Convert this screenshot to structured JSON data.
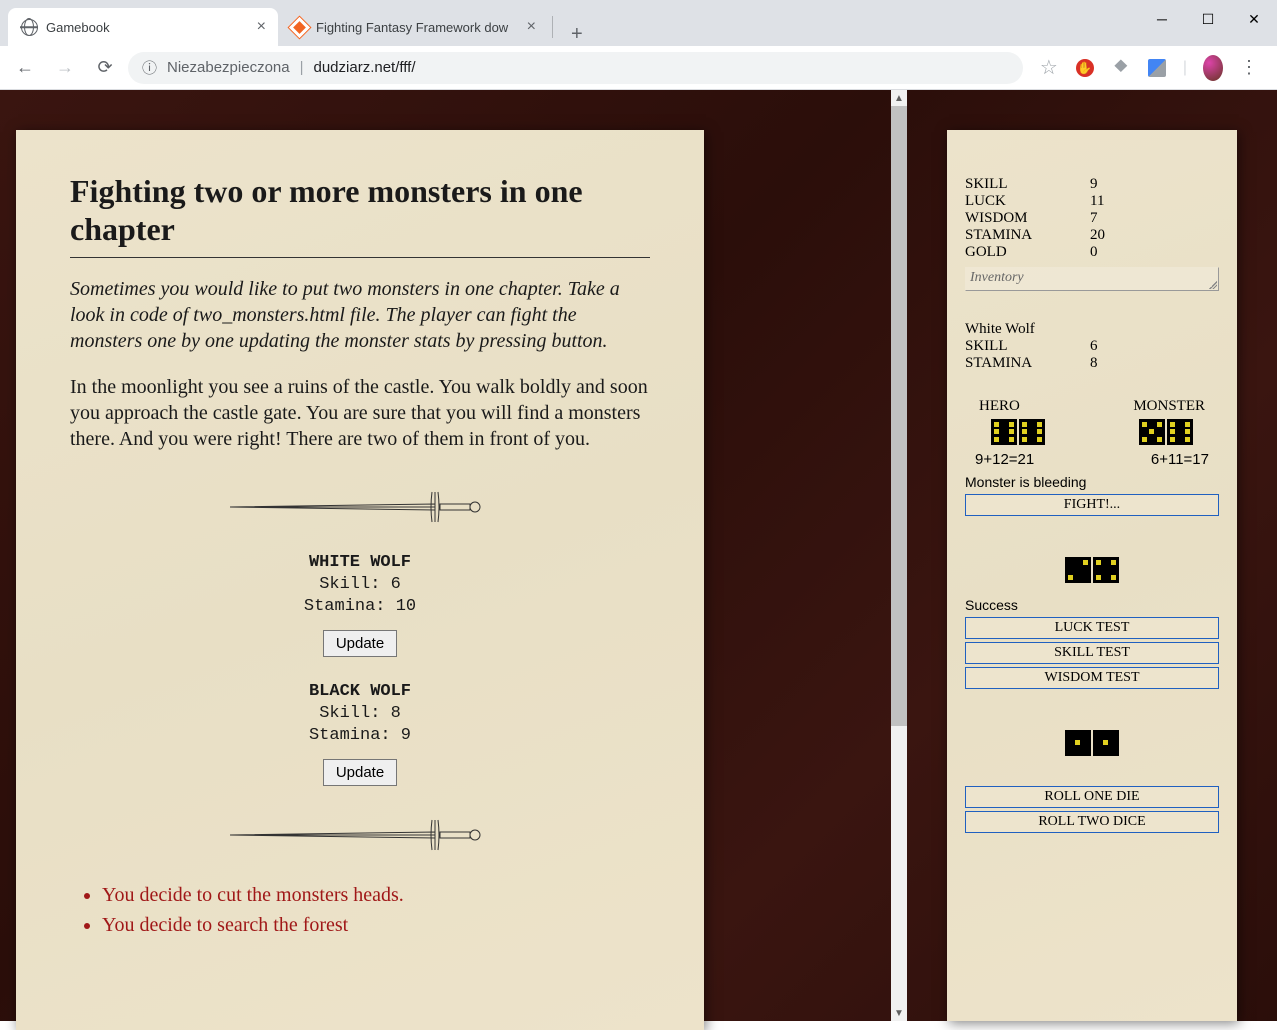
{
  "browser": {
    "tabs": [
      {
        "title": "Gamebook",
        "active": true
      },
      {
        "title": "Fighting Fantasy Framework dow",
        "active": false
      }
    ],
    "url_security": "Niezabezpieczona",
    "url": "dudziarz.net/fff/"
  },
  "page": {
    "title": "Fighting two or more monsters in one chapter",
    "intro": "Sometimes you would like to put two monsters in one chapter. Take a look in code of two_monsters.html file. The player can fight the monsters one by one updating the monster stats by pressing button.",
    "story": "In the moonlight you see a ruins of the castle. You walk boldly and soon you approach the castle gate. You are sure that you will find a monsters there. And you were right! There are two of them in front of you.",
    "monsters": [
      {
        "name": "WHITE WOLF",
        "skill_label": "Skill: 6",
        "stamina_label": "Stamina: 10",
        "button": "Update"
      },
      {
        "name": "BLACK WOLF",
        "skill_label": "Skill: 8",
        "stamina_label": "Stamina: 9",
        "button": "Update"
      }
    ],
    "choices": [
      "You decide to cut the monsters heads.",
      "You decide to search the forest"
    ]
  },
  "stats": {
    "hero": {
      "skill_label": "SKILL",
      "skill_val": "9",
      "luck_label": "LUCK",
      "luck_val": "11",
      "wisdom_label": "WISDOM",
      "wisdom_val": "7",
      "stamina_label": "STAMINA",
      "stamina_val": "20",
      "gold_label": "GOLD",
      "gold_val": "0",
      "inventory_label": "Inventory"
    },
    "enemy": {
      "name": "White Wolf",
      "skill_label": "SKILL",
      "skill_val": "6",
      "stamina_label": "STAMINA",
      "stamina_val": "8"
    },
    "combat": {
      "hero_label": "HERO",
      "monster_label": "MONSTER",
      "hero_calc": "9+12=21",
      "monster_calc": "6+11=17",
      "status": "Monster is bleeding",
      "fight_button": "FIGHT!..."
    },
    "luck": {
      "status": "Success",
      "luck_button": "LUCK TEST",
      "skill_button": "SKILL TEST",
      "wisdom_button": "WISDOM TEST"
    },
    "roll": {
      "one_button": "ROLL ONE DIE",
      "two_button": "ROLL TWO DICE"
    }
  }
}
